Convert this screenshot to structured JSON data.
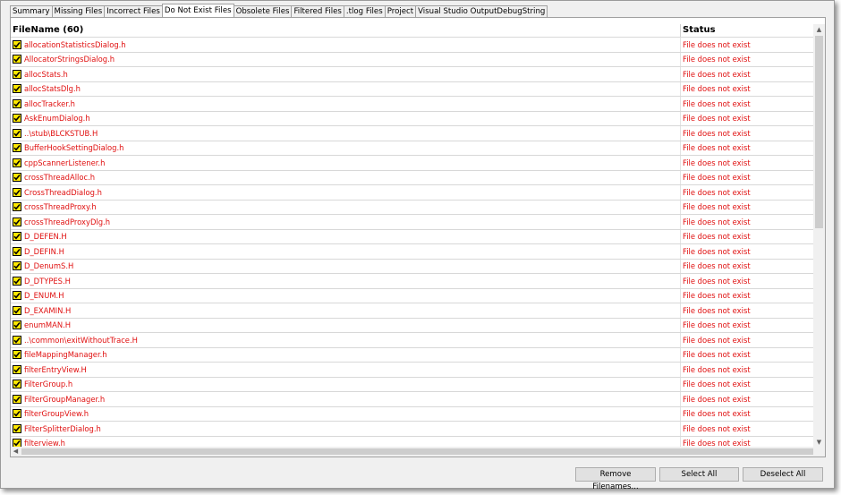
{
  "tabs": [
    {
      "label": "Summary",
      "active": false
    },
    {
      "label": "Missing Files",
      "active": false
    },
    {
      "label": "Incorrect Files",
      "active": false
    },
    {
      "label": "Do Not Exist Files",
      "active": true
    },
    {
      "label": "Obsolete Files",
      "active": false
    },
    {
      "label": "Filtered Files",
      "active": false
    },
    {
      "label": ".tlog Files",
      "active": false
    },
    {
      "label": "Project",
      "active": false
    },
    {
      "label": "Visual Studio OutputDebugString",
      "active": false
    }
  ],
  "list": {
    "columns": {
      "filename": "FileName (60)",
      "status": "Status"
    },
    "text_color": "#e01010",
    "checkbox_color": "#ffe800",
    "rows": [
      {
        "filename": "allocationStatisticsDialog.h",
        "status": "File does not exist",
        "checked": true
      },
      {
        "filename": "AllocatorStringsDialog.h",
        "status": "File does not exist",
        "checked": true
      },
      {
        "filename": "allocStats.h",
        "status": "File does not exist",
        "checked": true
      },
      {
        "filename": "allocStatsDlg.h",
        "status": "File does not exist",
        "checked": true
      },
      {
        "filename": "allocTracker.h",
        "status": "File does not exist",
        "checked": true
      },
      {
        "filename": "AskEnumDialog.h",
        "status": "File does not exist",
        "checked": true
      },
      {
        "filename": "..\\stub\\BLCKSTUB.H",
        "status": "File does not exist",
        "checked": true
      },
      {
        "filename": "BufferHookSettingDialog.h",
        "status": "File does not exist",
        "checked": true
      },
      {
        "filename": "cppScannerListener.h",
        "status": "File does not exist",
        "checked": true
      },
      {
        "filename": "crossThreadAlloc.h",
        "status": "File does not exist",
        "checked": true
      },
      {
        "filename": "CrossThreadDialog.h",
        "status": "File does not exist",
        "checked": true
      },
      {
        "filename": "crossThreadProxy.h",
        "status": "File does not exist",
        "checked": true
      },
      {
        "filename": "crossThreadProxyDlg.h",
        "status": "File does not exist",
        "checked": true
      },
      {
        "filename": "D_DEFEN.H",
        "status": "File does not exist",
        "checked": true
      },
      {
        "filename": "D_DEFIN.H",
        "status": "File does not exist",
        "checked": true
      },
      {
        "filename": "D_DenumS.H",
        "status": "File does not exist",
        "checked": true
      },
      {
        "filename": "D_DTYPES.H",
        "status": "File does not exist",
        "checked": true
      },
      {
        "filename": "D_ENUM.H",
        "status": "File does not exist",
        "checked": true
      },
      {
        "filename": "D_EXAMIN.H",
        "status": "File does not exist",
        "checked": true
      },
      {
        "filename": "enumMAN.H",
        "status": "File does not exist",
        "checked": true
      },
      {
        "filename": "..\\common\\exitWithoutTrace.H",
        "status": "File does not exist",
        "checked": true
      },
      {
        "filename": "fileMappingManager.h",
        "status": "File does not exist",
        "checked": true
      },
      {
        "filename": "filterEntryView.H",
        "status": "File does not exist",
        "checked": true
      },
      {
        "filename": "FilterGroup.h",
        "status": "File does not exist",
        "checked": true
      },
      {
        "filename": "FilterGroupManager.h",
        "status": "File does not exist",
        "checked": true
      },
      {
        "filename": "filterGroupView.h",
        "status": "File does not exist",
        "checked": true
      },
      {
        "filename": "FilterSplitterDialog.h",
        "status": "File does not exist",
        "checked": true
      },
      {
        "filename": "filterview.h",
        "status": "File does not exist",
        "checked": true
      }
    ]
  },
  "scrollbars": {
    "up_icon": "chevron-up-icon",
    "down_icon": "chevron-down-icon",
    "left_icon": "chevron-left-icon"
  },
  "buttons": {
    "remove": "Remove Filenames...",
    "select_all": "Select All",
    "deselect_all": "Deselect All"
  }
}
